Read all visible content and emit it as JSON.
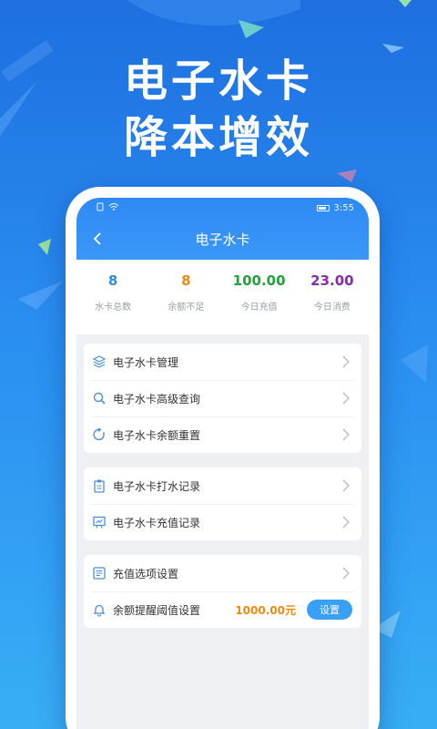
{
  "hero": {
    "line1": "电子水卡",
    "line2": "降本增效"
  },
  "status": {
    "time": "3:55"
  },
  "app": {
    "title": "电子水卡"
  },
  "stats": [
    {
      "value": "8",
      "label": "水卡总数",
      "color": "#2a8de8"
    },
    {
      "value": "8",
      "label": "余额不足",
      "color": "#ee8a12"
    },
    {
      "value": "100.00",
      "label": "今日充值",
      "color": "#1fa33a"
    },
    {
      "value": "23.00",
      "label": "今日消费",
      "color": "#8a2aa8"
    }
  ],
  "groups": {
    "g1": [
      {
        "label": "电子水卡管理",
        "icon": "layers-icon"
      },
      {
        "label": "电子水卡高级查询",
        "icon": "search-icon"
      },
      {
        "label": "电子水卡余额重置",
        "icon": "refresh-icon"
      }
    ],
    "g2": [
      {
        "label": "电子水卡打水记录",
        "icon": "clipboard-icon"
      },
      {
        "label": "电子水卡充值记录",
        "icon": "chart-board-icon"
      }
    ],
    "g3": [
      {
        "label": "充值选项设置",
        "icon": "list-settings-icon"
      },
      {
        "label": "余额提醒阈值设置",
        "icon": "bell-icon",
        "amount": "1000.00元",
        "button": "设置"
      }
    ]
  },
  "colors": {
    "accent": "#3a97f7",
    "orange": "#ee8a12"
  }
}
